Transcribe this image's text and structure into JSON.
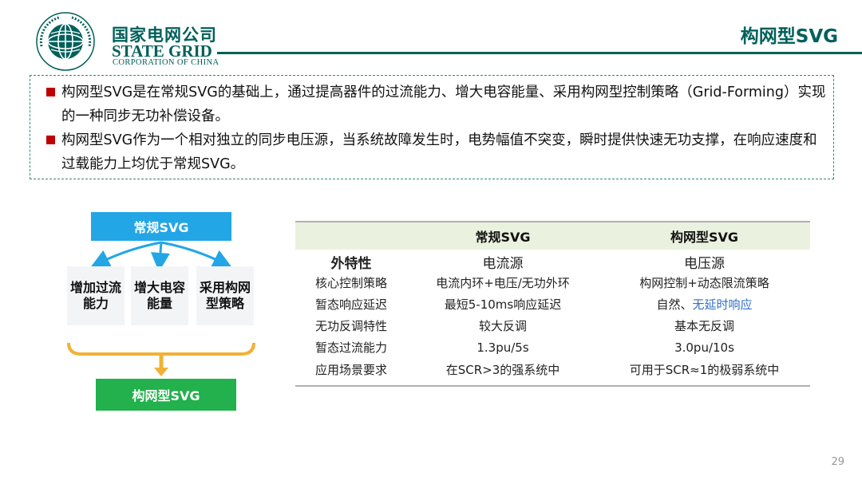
{
  "header": {
    "brand_cn": "国家电网公司",
    "brand_en": "STATE GRID",
    "brand_sub": "CORPORATION OF CHINA",
    "seal_text_cn": "国家电网公司",
    "seal_text_en": "STATE GRID CORPORATION OF CHINA",
    "page_title": "构网型SVG"
  },
  "intro": {
    "bullets": [
      "构网型SVG是在常规SVG的基础上，通过提高器件的过流能力、增大电容能量、采用构网型控制策略（Grid-Forming）实现的一种同步无功补偿设备。",
      "构网型SVG作为一个相对独立的同步电压源，当系统故障发生时，电势幅值不突变，瞬时提供快速无功支撑，在响应速度和过载能力上均优于常规SVG。"
    ]
  },
  "diagram": {
    "top_label": "常规SVG",
    "items": [
      "增加过流能力",
      "增大电容能量",
      "采用构网型策略"
    ],
    "bottom_label": "构网型SVG",
    "colors": {
      "top": "#22a6e6",
      "bottom": "#22b14c",
      "arrow": "#22a6e6",
      "bracket": "#f2b134"
    }
  },
  "table": {
    "headers": [
      "",
      "常规SVG",
      "构网型SVG"
    ],
    "rows": [
      [
        "外特性",
        "电流源",
        "电压源"
      ],
      [
        "核心控制策略",
        "电流内环+电压/无功外环",
        "构网控制+动态限流策略"
      ],
      [
        "暂态响应延迟",
        "最短5-10ms响应延迟",
        "自然、无延时响应"
      ],
      [
        "无功反调特性",
        "较大反调",
        "基本无反调"
      ],
      [
        "暂态过流能力",
        "1.3pu/5s",
        "3.0pu/10s"
      ],
      [
        "应用场景要求",
        "在SCR>3的强系统中",
        "可用于SCR≈1的极弱系统中"
      ]
    ],
    "row3_col3_prefix": "自然、",
    "row3_col3_highlight": "无延时响应",
    "colors": {
      "header_bg": "#eaf1df",
      "highlight": "#2f6fc4"
    }
  },
  "footer": {
    "page_number": "29"
  }
}
